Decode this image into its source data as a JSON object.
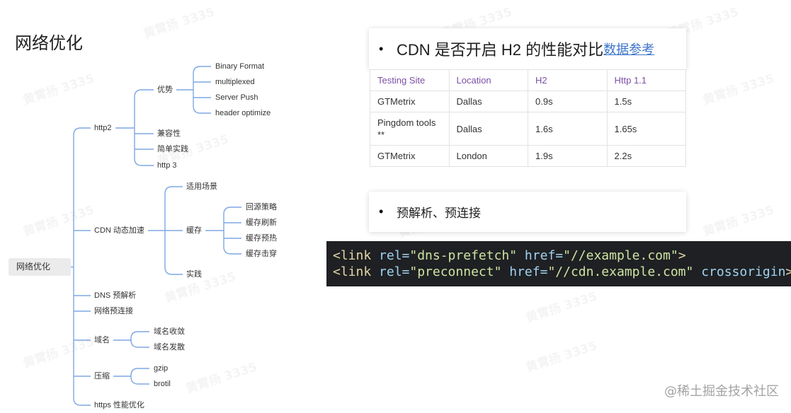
{
  "page": {
    "title": "网络优化"
  },
  "mindmap": {
    "root": "网络优化",
    "branches": [
      {
        "label": "http2",
        "children": [
          {
            "label": "优势",
            "children": [
              {
                "label": "Binary Format"
              },
              {
                "label": "multiplexed"
              },
              {
                "label": "Server Push"
              },
              {
                "label": "header optimize"
              }
            ]
          },
          {
            "label": "兼容性"
          },
          {
            "label": "简单实践"
          },
          {
            "label": "http 3"
          }
        ]
      },
      {
        "label": "CDN 动态加速",
        "children": [
          {
            "label": "适用场景"
          },
          {
            "label": "缓存",
            "children": [
              {
                "label": "回源策略"
              },
              {
                "label": "缓存刷新"
              },
              {
                "label": "缓存预热"
              },
              {
                "label": "缓存击穿"
              }
            ]
          },
          {
            "label": "实践"
          }
        ]
      },
      {
        "label": "DNS 预解析"
      },
      {
        "label": "网络预连接"
      },
      {
        "label": "域名",
        "children": [
          {
            "label": "域名收敛"
          },
          {
            "label": "域名发散"
          }
        ]
      },
      {
        "label": "压缩",
        "children": [
          {
            "label": "gzip"
          },
          {
            "label": "brotil"
          }
        ]
      },
      {
        "label": "https 性能优化"
      }
    ]
  },
  "cdn_card": {
    "bullet": "•",
    "text": "CDN 是否开启 H2 的性能对比",
    "link_text": "数据参考"
  },
  "table": {
    "headers": [
      "Testing Site",
      "Location",
      "H2",
      "Http 1.1"
    ],
    "rows": [
      [
        "GTMetrix",
        "Dallas",
        "0.9s",
        "1.5s"
      ],
      [
        "Pingdom tools **",
        "Dallas",
        "1.6s",
        "1.65s"
      ],
      [
        "GTMetrix",
        "London",
        "1.9s",
        "2.2s"
      ]
    ]
  },
  "preload_card": {
    "bullet": "•",
    "text": "预解析、预连接"
  },
  "code": {
    "lines": [
      [
        "<link",
        " rel=",
        "\"dns-prefetch\"",
        " href=",
        "\"//example.com\"",
        ">"
      ],
      [
        "<link",
        " rel=",
        "\"preconnect\"",
        " href=",
        "\"//cdn.example.com\"",
        " crossorigin",
        ">"
      ]
    ]
  },
  "watermark": {
    "text": "黄霄扬 3335",
    "credit": "@稀土掘金技术社区"
  },
  "colors": {
    "connector": "#7fa7e3",
    "link": "#3d74c9",
    "th": "#7b4fa6",
    "code-bg": "#1f2023",
    "code-tag": "#e3d6a4",
    "code-attr": "#9fd3f2",
    "code-str": "#cfe3a2",
    "root-bg": "#ebebeb"
  }
}
